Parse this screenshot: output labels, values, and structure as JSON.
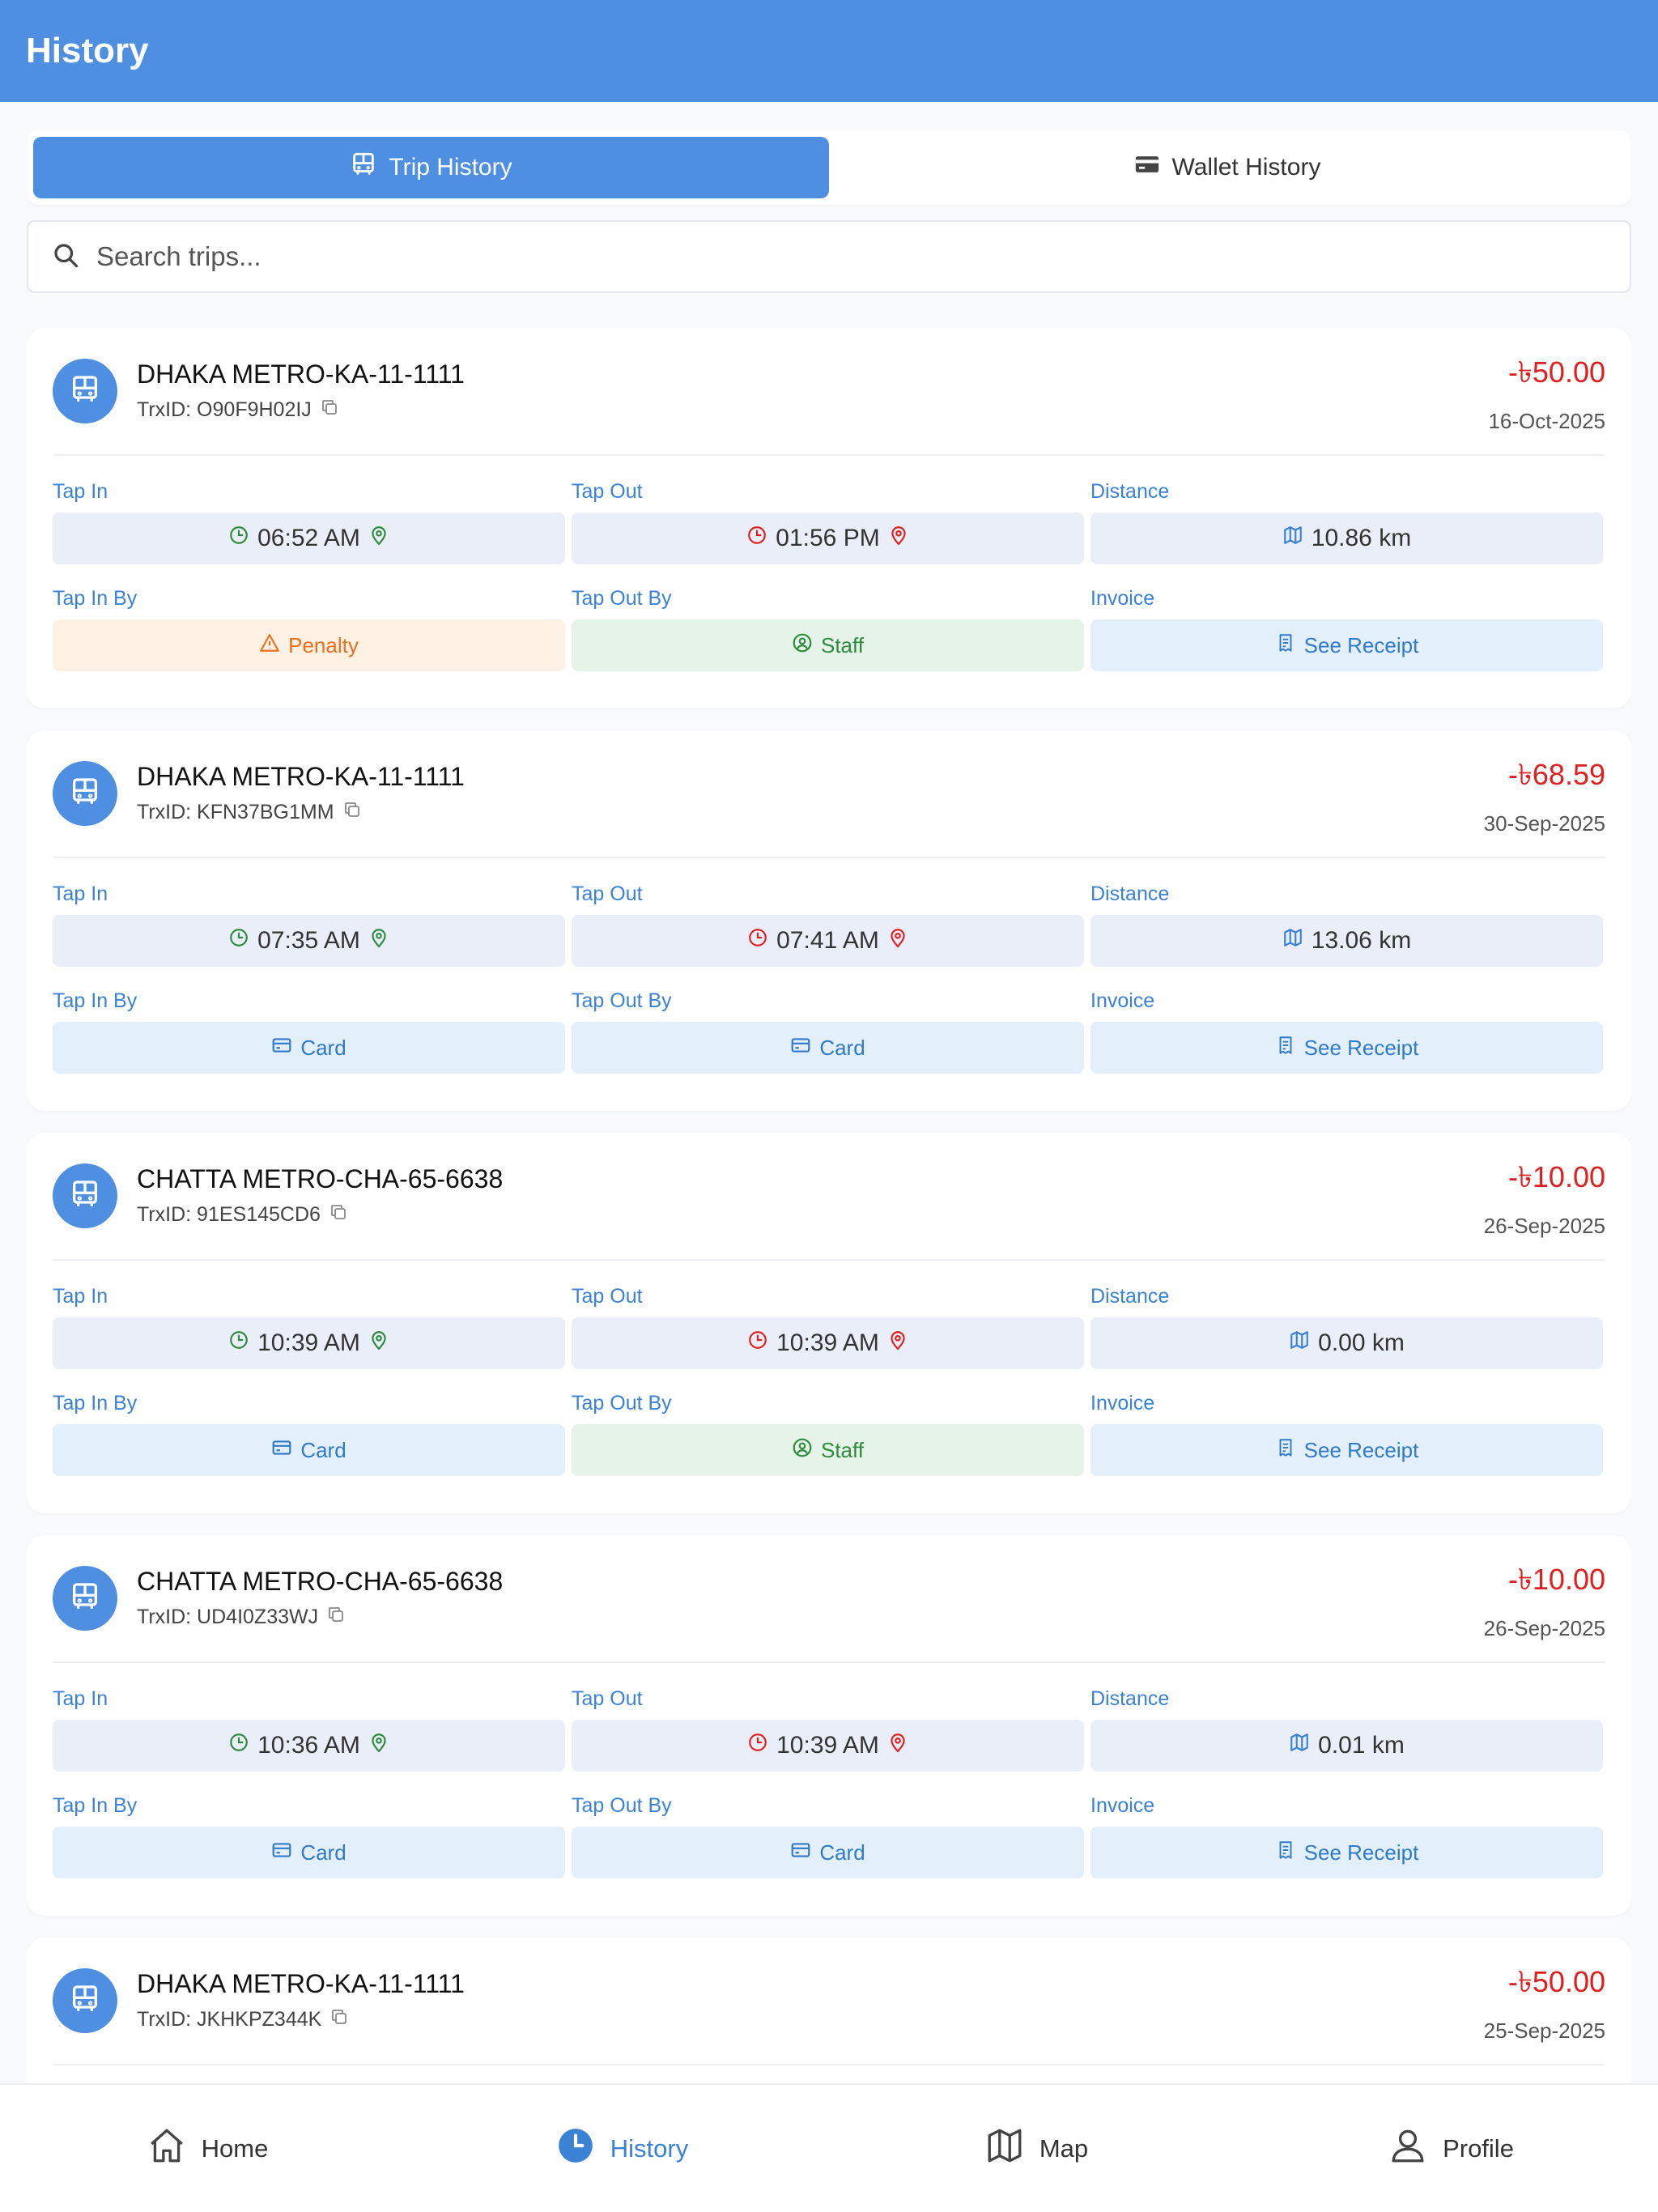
{
  "header": {
    "title": "History"
  },
  "tabs": [
    {
      "label": "Trip History",
      "icon": "bus-icon",
      "active": true
    },
    {
      "label": "Wallet History",
      "icon": "wallet-icon",
      "active": false
    }
  ],
  "search": {
    "placeholder": "Search trips..."
  },
  "labels": {
    "tap_in": "Tap In",
    "tap_out": "Tap Out",
    "distance": "Distance",
    "tap_in_by": "Tap In By",
    "tap_out_by": "Tap Out By",
    "invoice": "Invoice",
    "see_receipt": "See Receipt"
  },
  "trips": [
    {
      "vehicle": "DHAKA METRO-KA-11-1111",
      "trx": "TrxID: O90F9H02IJ",
      "amount": "-৳50.00",
      "date": "16-Oct-2025",
      "tap_in": "06:52 AM",
      "tap_out": "01:56 PM",
      "distance": "10.86 km",
      "tap_in_by": "Penalty",
      "tap_in_by_type": "penalty",
      "tap_out_by": "Staff",
      "tap_out_by_type": "staff"
    },
    {
      "vehicle": "DHAKA METRO-KA-11-1111",
      "trx": "TrxID: KFN37BG1MM",
      "amount": "-৳68.59",
      "date": "30-Sep-2025",
      "tap_in": "07:35 AM",
      "tap_out": "07:41 AM",
      "distance": "13.06 km",
      "tap_in_by": "Card",
      "tap_in_by_type": "card",
      "tap_out_by": "Card",
      "tap_out_by_type": "card"
    },
    {
      "vehicle": "CHATTA METRO-CHA-65-6638",
      "trx": "TrxID: 91ES145CD6",
      "amount": "-৳10.00",
      "date": "26-Sep-2025",
      "tap_in": "10:39 AM",
      "tap_out": "10:39 AM",
      "distance": "0.00 km",
      "tap_in_by": "Card",
      "tap_in_by_type": "card",
      "tap_out_by": "Staff",
      "tap_out_by_type": "staff"
    },
    {
      "vehicle": "CHATTA METRO-CHA-65-6638",
      "trx": "TrxID: UD4I0Z33WJ",
      "amount": "-৳10.00",
      "date": "26-Sep-2025",
      "tap_in": "10:36 AM",
      "tap_out": "10:39 AM",
      "distance": "0.01 km",
      "tap_in_by": "Card",
      "tap_in_by_type": "card",
      "tap_out_by": "Card",
      "tap_out_by_type": "card"
    },
    {
      "vehicle": "DHAKA METRO-KA-11-1111",
      "trx": "TrxID: JKHKPZ344K",
      "amount": "-৳50.00",
      "date": "25-Sep-2025",
      "tap_in": "",
      "tap_out": "",
      "distance": "",
      "tap_in_by": "",
      "tap_in_by_type": "card",
      "tap_out_by": "",
      "tap_out_by_type": "card"
    }
  ],
  "bottom_nav": [
    {
      "label": "Home",
      "icon": "home-icon",
      "active": false
    },
    {
      "label": "History",
      "icon": "clock-icon",
      "active": true
    },
    {
      "label": "Map",
      "icon": "map-icon",
      "active": false
    },
    {
      "label": "Profile",
      "icon": "user-icon",
      "active": false
    }
  ],
  "colors": {
    "primary": "#4e8fe2",
    "amount": "#e02020",
    "label": "#3b82d4",
    "penalty": "#e8711f",
    "staff": "#2e8b3d"
  }
}
